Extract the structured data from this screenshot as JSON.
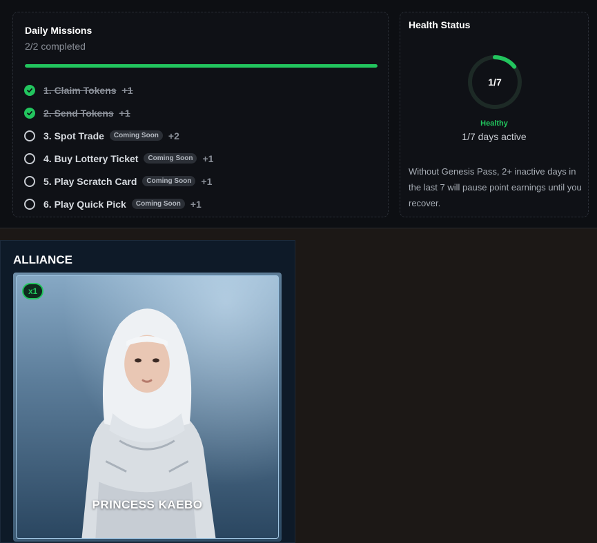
{
  "missions": {
    "title": "Daily Missions",
    "progress_text": "2/2 completed",
    "progress_fraction": 1.0,
    "items": [
      {
        "label": "1. Claim Tokens",
        "badge": "",
        "points": "+1",
        "done": true
      },
      {
        "label": "2. Send Tokens",
        "badge": "",
        "points": "+1",
        "done": true
      },
      {
        "label": "3. Spot Trade",
        "badge": "Coming Soon",
        "points": "+2",
        "done": false
      },
      {
        "label": "4. Buy Lottery Ticket",
        "badge": "Coming Soon",
        "points": "+1",
        "done": false
      },
      {
        "label": "5. Play Scratch Card",
        "badge": "Coming Soon",
        "points": "+1",
        "done": false
      },
      {
        "label": "6. Play Quick Pick",
        "badge": "Coming Soon",
        "points": "+1",
        "done": false
      }
    ]
  },
  "health": {
    "title": "Health Status",
    "ring_label": "1/7",
    "ring_fraction": 0.1429,
    "state": "Healthy",
    "days_active": "1/7 days active",
    "note": "Without Genesis Pass, 2+ inactive days in the last 7 will pause point earnings until you recover."
  },
  "alliance": {
    "title": "ALLIANCE",
    "multiplier": "x1",
    "character_name": "PRINCESS KAEBO"
  },
  "colors": {
    "accent_green": "#22c55e",
    "panel_dark": "#0f1116",
    "alliance_bg": "#0e1a28"
  }
}
